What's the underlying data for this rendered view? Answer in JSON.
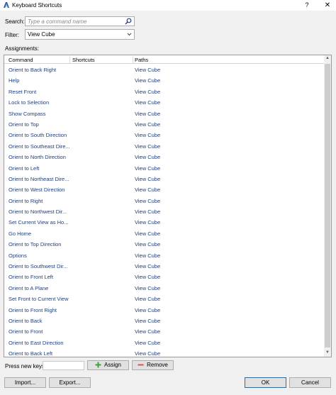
{
  "window": {
    "title": "Keyboard Shortcuts",
    "help_label": "?",
    "close_label": "✕"
  },
  "search": {
    "label": "Search:",
    "placeholder": "Type a command name",
    "value": ""
  },
  "filter": {
    "label": "Filter:",
    "selected": "View Cube"
  },
  "assignments": {
    "label": "Assignments:",
    "columns": [
      "Command",
      "Shortcuts",
      "Paths"
    ],
    "rows": [
      {
        "command": "Orient to Back Right",
        "shortcut": "",
        "path": "View Cube"
      },
      {
        "command": "Help",
        "shortcut": "",
        "path": "View Cube"
      },
      {
        "command": "Reset Front",
        "shortcut": "",
        "path": "View Cube"
      },
      {
        "command": "Lock to Selection",
        "shortcut": "",
        "path": "View Cube"
      },
      {
        "command": "Show Compass",
        "shortcut": "",
        "path": "View Cube"
      },
      {
        "command": "Orient to Top",
        "shortcut": "",
        "path": "View Cube"
      },
      {
        "command": "Orient to South Direction",
        "shortcut": "",
        "path": "View Cube"
      },
      {
        "command": "Orient to Southeast Dire...",
        "shortcut": "",
        "path": "View Cube"
      },
      {
        "command": "Orient to North Direction",
        "shortcut": "",
        "path": "View Cube"
      },
      {
        "command": "Orient to Left",
        "shortcut": "",
        "path": "View Cube"
      },
      {
        "command": "Orient to Northeast Dire...",
        "shortcut": "",
        "path": "View Cube"
      },
      {
        "command": "Orient to West Direction",
        "shortcut": "",
        "path": "View Cube"
      },
      {
        "command": "Orient to Right",
        "shortcut": "",
        "path": "View Cube"
      },
      {
        "command": "Orient to Northwest Dir...",
        "shortcut": "",
        "path": "View Cube"
      },
      {
        "command": "Set Current View as Ho...",
        "shortcut": "",
        "path": "View Cube"
      },
      {
        "command": "Go Home",
        "shortcut": "",
        "path": "View Cube"
      },
      {
        "command": "Orient to Top Direction",
        "shortcut": "",
        "path": "View Cube"
      },
      {
        "command": "Options",
        "shortcut": "",
        "path": "View Cube"
      },
      {
        "command": "Orient to Southwest Dir...",
        "shortcut": "",
        "path": "View Cube"
      },
      {
        "command": "Orient to Front Left",
        "shortcut": "",
        "path": "View Cube"
      },
      {
        "command": "Orient to A Plane",
        "shortcut": "",
        "path": "View Cube"
      },
      {
        "command": "Set Front to Current View",
        "shortcut": "",
        "path": "View Cube"
      },
      {
        "command": "Orient to Front Right",
        "shortcut": "",
        "path": "View Cube"
      },
      {
        "command": "Orient to Back",
        "shortcut": "",
        "path": "View Cube"
      },
      {
        "command": "Orient to Front",
        "shortcut": "",
        "path": "View Cube"
      },
      {
        "command": "Orient to East Direction",
        "shortcut": "",
        "path": "View Cube"
      },
      {
        "command": "Orient to Back Left",
        "shortcut": "",
        "path": "View Cube"
      }
    ]
  },
  "new_keys": {
    "label": "Press new keys:",
    "value": ""
  },
  "buttons": {
    "assign": "Assign",
    "remove": "Remove",
    "import": "Import...",
    "export": "Export...",
    "ok": "OK",
    "cancel": "Cancel"
  },
  "icons": {
    "app": "revit-logo-icon",
    "search": "search-icon",
    "assign": "plus-icon",
    "remove": "minus-icon"
  },
  "colors": {
    "link_text": "#1a3f8f",
    "assign_green": "#3aa53a",
    "remove_red": "#d9534f",
    "ok_border": "#0078d7"
  }
}
